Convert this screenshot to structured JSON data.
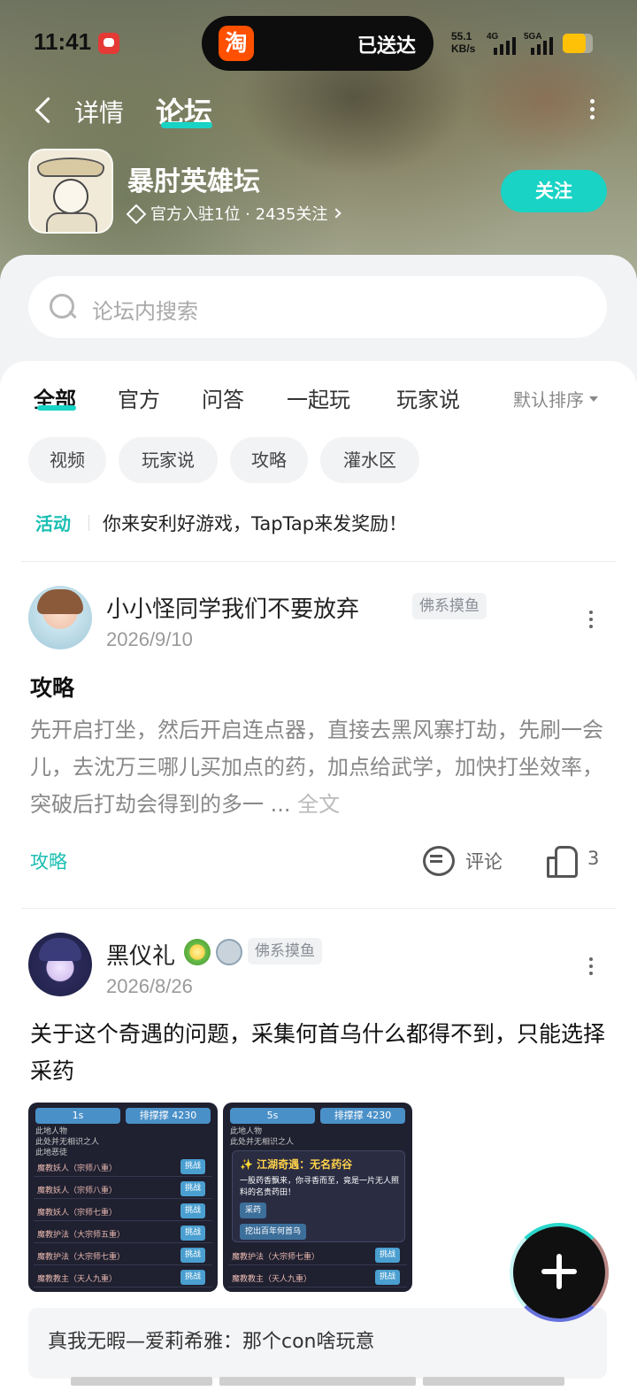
{
  "status_bar": {
    "time": "11:41",
    "island_app": "淘",
    "island_text": "已送达",
    "net_speed_value": "55.1",
    "net_speed_unit": "KB/s",
    "sim1_label": "4G",
    "sim2_label": "5GA"
  },
  "nav": {
    "back_icon": "chevron-left-icon",
    "tab_detail": "详情",
    "tab_forum": "论坛",
    "accent_color": "#19d3c5"
  },
  "app": {
    "name": "暴肘英雄坛",
    "meta": "官方入驻1位 · 2435关注",
    "follow_label": "关注"
  },
  "search": {
    "placeholder": "论坛内搜索"
  },
  "categories": {
    "tabs": [
      "全部",
      "官方",
      "问答",
      "一起玩",
      "玩家说"
    ],
    "active_index": 0,
    "sort_label": "默认排序"
  },
  "chips": [
    "视频",
    "玩家说",
    "攻略",
    "灌水区"
  ],
  "activity": {
    "label": "活动",
    "text": "你来安利好游戏，TapTap来发奖励！"
  },
  "posts": [
    {
      "username": "小小怪同学我们不要放弃",
      "badge": "佛系摸鱼",
      "date": "2026/9/10",
      "title": "攻略",
      "body": "先开启打坐，然后开启连点器，直接去黑风寨打劫，先刷一会儿，去沈万三哪儿买加点的药，加点给武学，加快打坐效率，突破后打劫会得到的多一",
      "ellipsis": "...",
      "fulltext": "全文",
      "tag": "攻略",
      "comment_label": "评论",
      "like_count": "3"
    },
    {
      "username": "黑仪礼",
      "badge": "佛系摸鱼",
      "date": "2026/8/26",
      "body": "关于这个奇遇的问题，采集何首乌什么都得不到，只能选择采药",
      "images": [
        {
          "timer": "1s",
          "btn_right": "排撑撑 4230",
          "header_line": "此地人物",
          "sub_line": "此处并无相识之人",
          "group_line": "此地恶徒",
          "rows": [
            "魔教妖人（宗师八重）",
            "魔教妖人（宗师八重）",
            "魔教妖人（宗师七重）",
            "魔教护法（大宗师五重）",
            "魔教护法（大宗师七重）",
            "魔教教主（天人九重）"
          ],
          "action": "挑战"
        },
        {
          "timer": "5s",
          "btn_right": "排撑撑 4230",
          "header_line": "此地人物",
          "sub_line": "此处并无相识之人",
          "dialog_title": "✨ 江湖奇遇：无名药谷",
          "dialog_text": "一股药香飘来，你寻香而至，竟是一片无人照料的名贵药田！",
          "option_1": "采药",
          "option_2": "挖出百年何首乌",
          "rows": [
            "魔教护法（大宗师七重）",
            "魔教教主（天人九重）"
          ],
          "action": "挑战"
        }
      ],
      "comment_preview": "真我无暇—爱莉希雅：那个con啥玩意"
    }
  ]
}
